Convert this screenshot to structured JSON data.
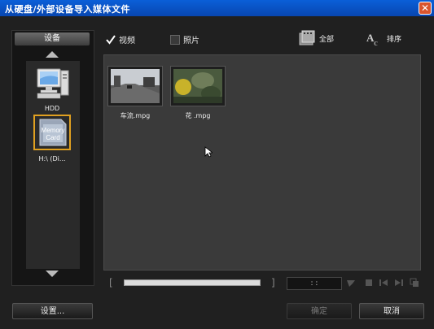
{
  "window": {
    "title": "从硬盘/外部设备导入媒体文件",
    "close_glyph": "✕"
  },
  "sidebar": {
    "header": "设备",
    "devices": [
      {
        "label": "HDD",
        "icon": "computer-icon"
      },
      {
        "label": "H:\\ (Di...",
        "icon": "memory-card-icon",
        "card_text": [
          "Memory",
          "Card"
        ]
      }
    ]
  },
  "toolbar": {
    "video_label": "视频",
    "photo_label": "照片",
    "all_label": "全部",
    "sort_label": "排序"
  },
  "files": [
    {
      "name": "车流.mpg"
    },
    {
      "name": "花 .mpg"
    }
  ],
  "player": {
    "time": ":      :",
    "bracket_left": "[",
    "bracket_right": "]"
  },
  "buttons": {
    "settings": "设置...",
    "ok": "确定",
    "cancel": "取消"
  },
  "colors": {
    "title_bar": "#0a5fd8",
    "selection": "#e0a020"
  }
}
